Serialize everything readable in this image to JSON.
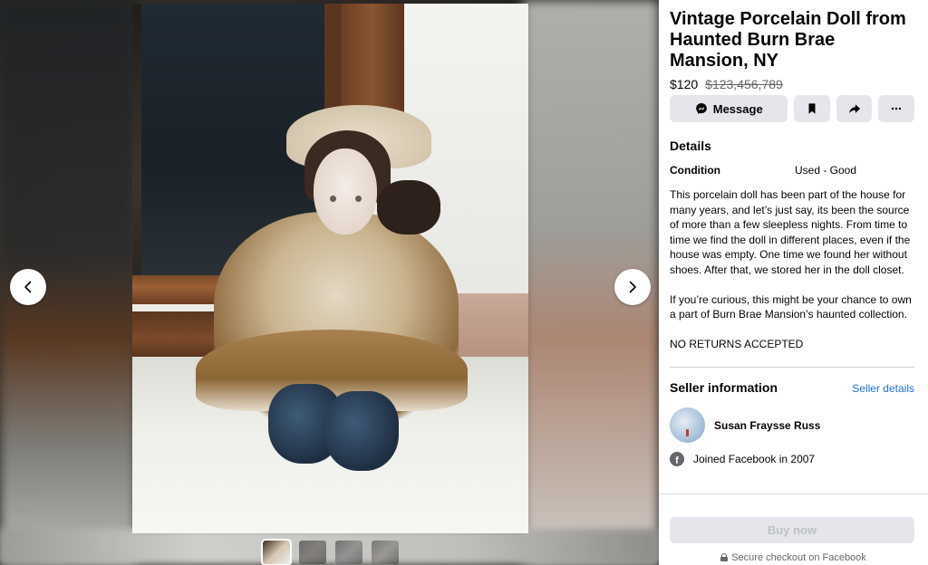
{
  "listing": {
    "title": "Vintage Porcelain Doll from Haunted Burn Brae Mansion, NY",
    "price": "$120",
    "original_price": "$123,456,789"
  },
  "actions": {
    "message_label": "Message",
    "save_icon": "bookmark-icon",
    "share_icon": "share-icon",
    "more_icon": "more-icon"
  },
  "details": {
    "heading": "Details",
    "condition_label": "Condition",
    "condition_value": "Used - Good",
    "description": [
      "This porcelain doll has been part of the house for many years, and let’s just say, its been the source of more than a few sleepless nights. From time to time we find the doll in different places, even if the house was empty. One time we found her without shoes. After that, we stored her in the doll closet.",
      "If you’re curious, this might be your chance to own a part of Burn Brae Mansion’s haunted collection.",
      "NO RETURNS ACCEPTED"
    ]
  },
  "seller": {
    "heading": "Seller information",
    "details_link": "Seller details",
    "name": "Susan Fraysse Russ",
    "joined": "Joined Facebook in 2007"
  },
  "footer": {
    "buy_label": "Buy now",
    "secure_text": "Secure checkout on Facebook"
  },
  "media": {
    "image_count": 4,
    "active_index": 0
  },
  "colors": {
    "accent_link": "#216fdb",
    "button_bg": "#e4e6eb",
    "muted_text": "#65676b"
  }
}
